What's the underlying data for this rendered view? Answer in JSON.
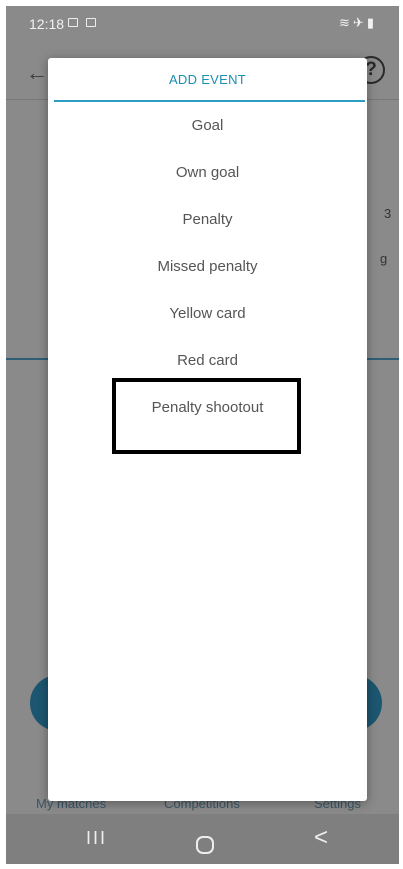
{
  "status_bar": {
    "time": "12:18",
    "right_icons": "wifi airplane battery"
  },
  "background": {
    "frag_a": "3",
    "frag_b": "g",
    "bottom_nav": [
      "My matches",
      "Competitions",
      "Settings"
    ]
  },
  "dialog": {
    "title": "ADD EVENT",
    "events": [
      "Goal",
      "Own goal",
      "Penalty",
      "Missed penalty",
      "Yellow card",
      "Red card",
      "Penalty shootout"
    ]
  },
  "system_nav": {
    "recents": "III",
    "home": "home",
    "back": "<"
  },
  "colors": {
    "accent": "#1b8fb3",
    "scrim": "#8a8a8a",
    "highlight": "#000000"
  }
}
